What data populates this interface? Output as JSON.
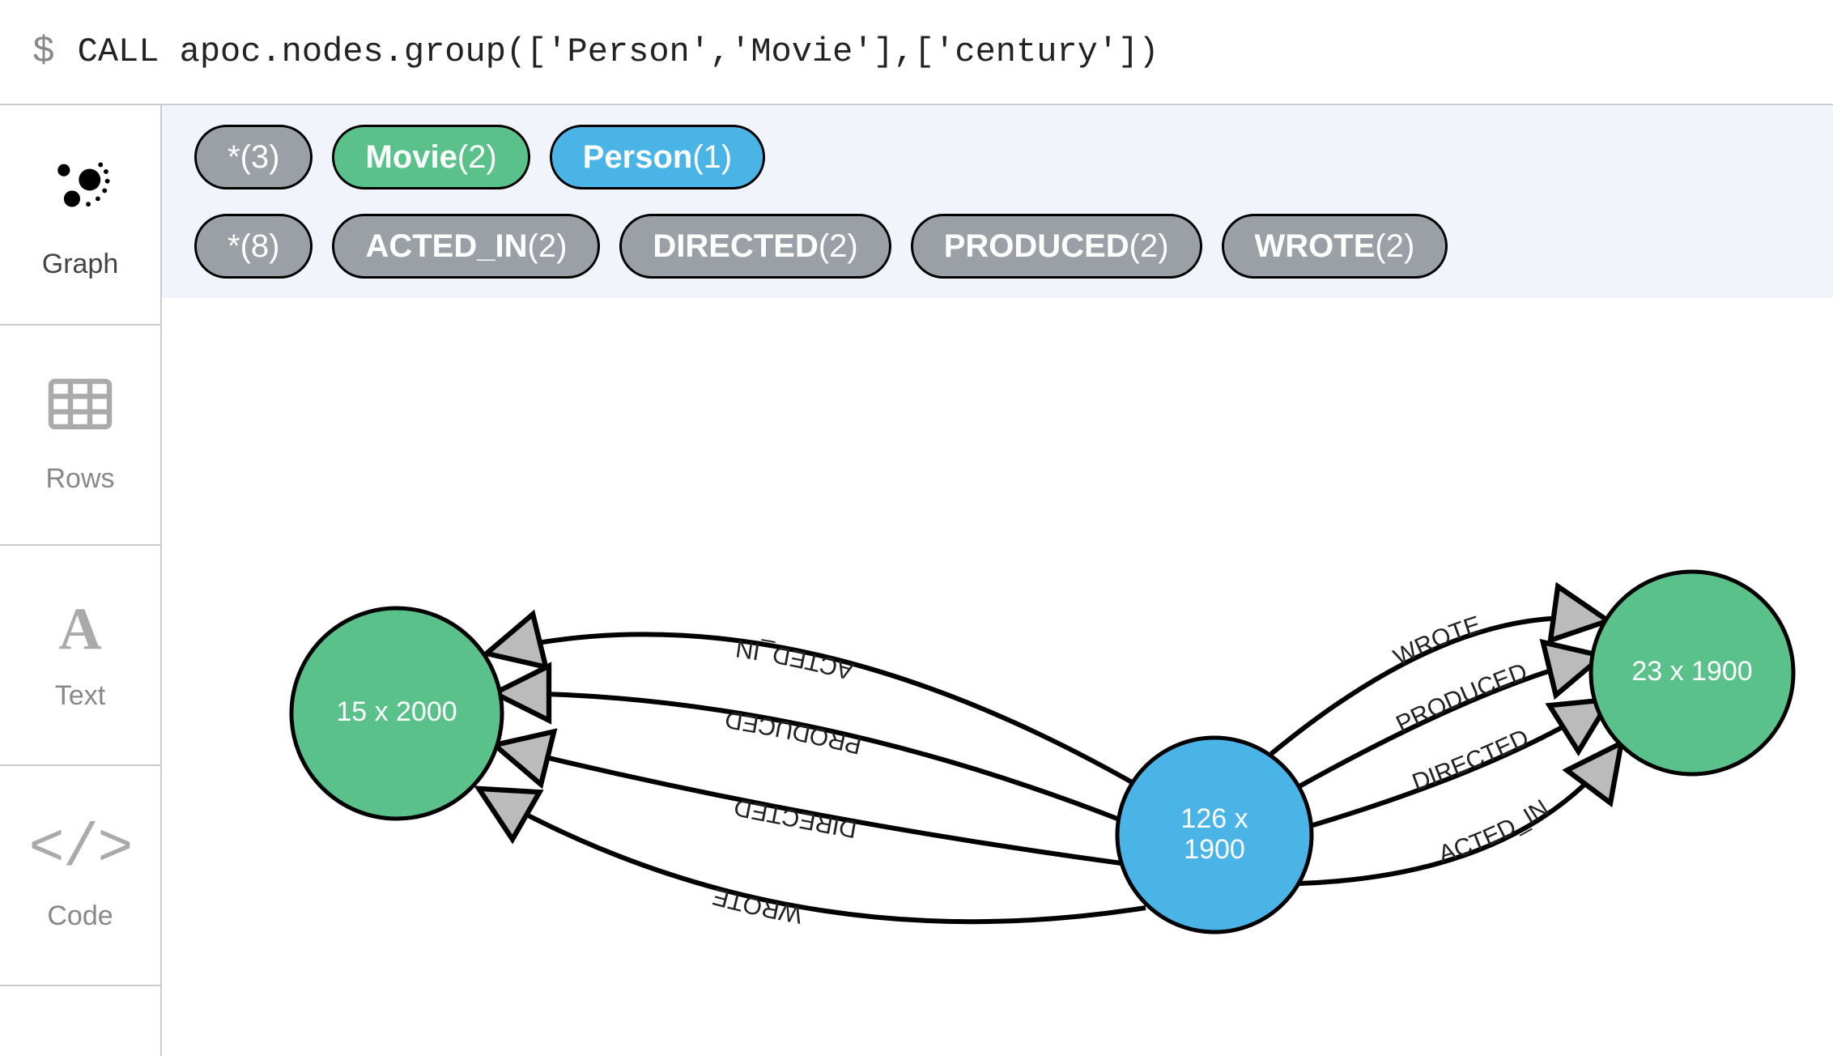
{
  "query": {
    "prompt": "$",
    "text": "CALL apoc.nodes.group(['Person','Movie'],['century'])"
  },
  "sidebar": {
    "tabs": [
      {
        "id": "graph",
        "label": "Graph",
        "active": true
      },
      {
        "id": "rows",
        "label": "Rows",
        "active": false
      },
      {
        "id": "text",
        "label": "Text",
        "active": false
      },
      {
        "id": "code",
        "label": "Code",
        "active": false
      }
    ]
  },
  "node_chips": [
    {
      "label": "*",
      "count": "(3)",
      "color": "grey"
    },
    {
      "label": "Movie",
      "count": "(2)",
      "color": "green"
    },
    {
      "label": "Person",
      "count": "(1)",
      "color": "blue"
    }
  ],
  "rel_chips": [
    {
      "label": "*",
      "count": "(8)",
      "color": "grey"
    },
    {
      "label": "ACTED_IN",
      "count": "(2)",
      "color": "grey"
    },
    {
      "label": "DIRECTED",
      "count": "(2)",
      "color": "grey"
    },
    {
      "label": "PRODUCED",
      "count": "(2)",
      "color": "grey"
    },
    {
      "label": "WROTE",
      "count": "(2)",
      "color": "grey"
    }
  ],
  "graph": {
    "nodes": [
      {
        "id": "movie2000",
        "label": "15 x 2000",
        "type": "Movie",
        "color": "green"
      },
      {
        "id": "person1900",
        "label1": "126 x",
        "label2": "1900",
        "type": "Person",
        "color": "blue"
      },
      {
        "id": "movie1900",
        "label": "23 x 1900",
        "type": "Movie",
        "color": "green"
      }
    ],
    "edges_left": [
      {
        "label": "ACTED_IN"
      },
      {
        "label": "PRODUCED"
      },
      {
        "label": "DIRECTED"
      },
      {
        "label": "WROTE"
      }
    ],
    "edges_right": [
      {
        "label": "WROTE"
      },
      {
        "label": "PRODUCED"
      },
      {
        "label": "DIRECTED"
      },
      {
        "label": "ACTED_IN"
      }
    ]
  }
}
